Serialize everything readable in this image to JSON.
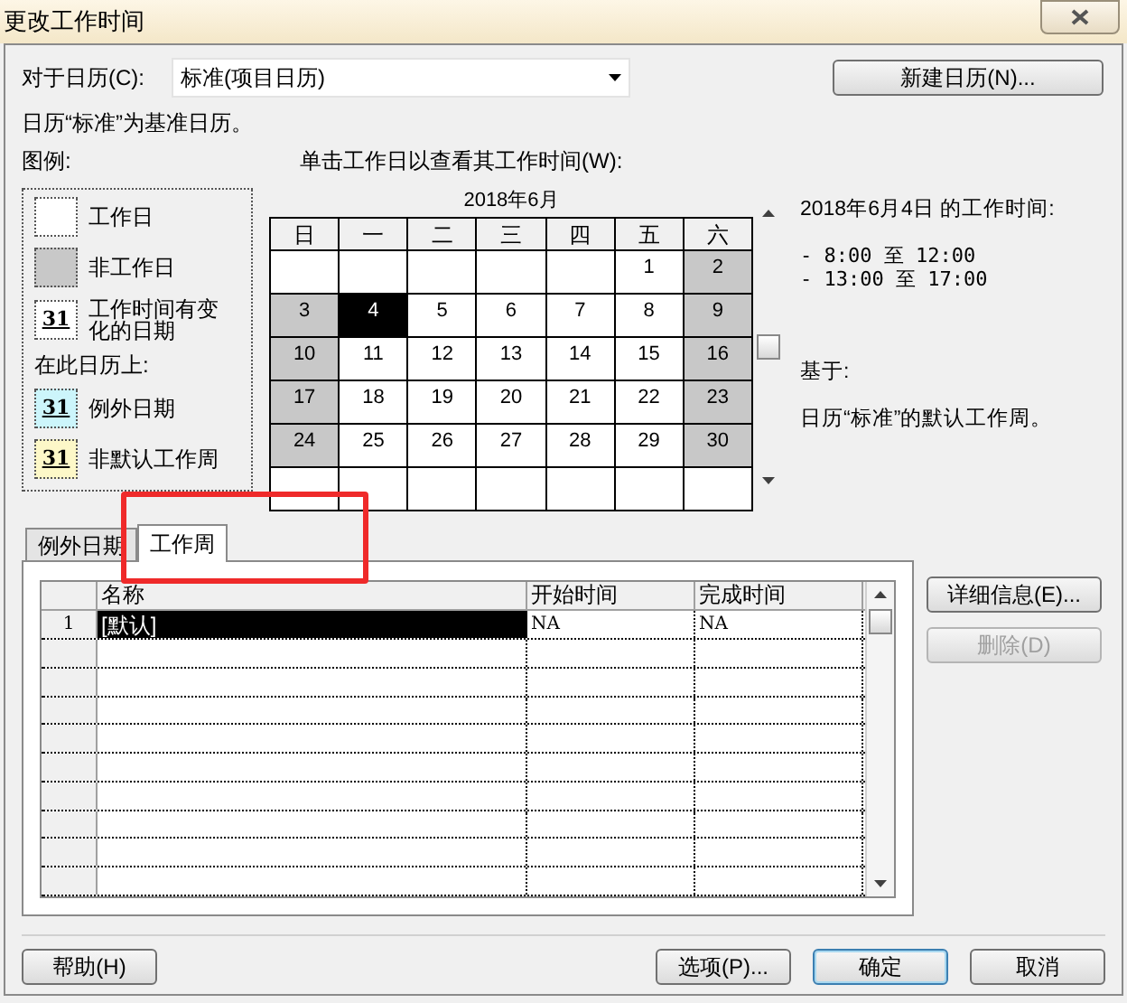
{
  "window": {
    "title": "更改工作时间"
  },
  "calendar_select": {
    "label": "对于日历(C):",
    "value": "标准(项目日历)"
  },
  "new_calendar_button": "新建日历(N)...",
  "base_note": "日历“标准”为基准日历。",
  "legend": {
    "title": "图例:",
    "subtitle": "在此日历上:",
    "items": [
      {
        "kind": "working",
        "label": "工作日"
      },
      {
        "kind": "nonworking",
        "label": "非工作日"
      },
      {
        "kind": "changed",
        "label": "工作时间有变化的日期",
        "sample": "31"
      },
      {
        "kind": "exception",
        "label": "例外日期",
        "sample": "31"
      },
      {
        "kind": "nondefault",
        "label": "非默认工作周",
        "sample": "31"
      }
    ]
  },
  "calendar": {
    "instruction": "单击工作日以查看其工作时间(W):",
    "month": "2018年6月",
    "weekdays": [
      "日",
      "一",
      "二",
      "三",
      "四",
      "五",
      "六"
    ],
    "weeks": [
      [
        {
          "kind": "working",
          "selected": false
        },
        {
          "kind": "working",
          "selected": false
        },
        {
          "kind": "working",
          "selected": false
        },
        {
          "kind": "working",
          "selected": false
        },
        {
          "kind": "working",
          "selected": false
        },
        {
          "day": "1",
          "kind": "working",
          "selected": false
        },
        {
          "day": "2",
          "kind": "nonworking",
          "selected": false
        }
      ],
      [
        {
          "day": "3",
          "kind": "nonworking",
          "selected": false
        },
        {
          "day": "4",
          "kind": "working",
          "selected": true
        },
        {
          "day": "5",
          "kind": "working",
          "selected": false
        },
        {
          "day": "6",
          "kind": "working",
          "selected": false
        },
        {
          "day": "7",
          "kind": "working",
          "selected": false
        },
        {
          "day": "8",
          "kind": "working",
          "selected": false
        },
        {
          "day": "9",
          "kind": "nonworking",
          "selected": false
        }
      ],
      [
        {
          "day": "10",
          "kind": "nonworking",
          "selected": false
        },
        {
          "day": "11",
          "kind": "working",
          "selected": false
        },
        {
          "day": "12",
          "kind": "working",
          "selected": false
        },
        {
          "day": "13",
          "kind": "working",
          "selected": false
        },
        {
          "day": "14",
          "kind": "working",
          "selected": false
        },
        {
          "day": "15",
          "kind": "working",
          "selected": false
        },
        {
          "day": "16",
          "kind": "nonworking",
          "selected": false
        }
      ],
      [
        {
          "day": "17",
          "kind": "nonworking",
          "selected": false
        },
        {
          "day": "18",
          "kind": "working",
          "selected": false
        },
        {
          "day": "19",
          "kind": "working",
          "selected": false
        },
        {
          "day": "20",
          "kind": "working",
          "selected": false
        },
        {
          "day": "21",
          "kind": "working",
          "selected": false
        },
        {
          "day": "22",
          "kind": "working",
          "selected": false
        },
        {
          "day": "23",
          "kind": "nonworking",
          "selected": false
        }
      ],
      [
        {
          "day": "24",
          "kind": "nonworking",
          "selected": false
        },
        {
          "day": "25",
          "kind": "working",
          "selected": false
        },
        {
          "day": "26",
          "kind": "working",
          "selected": false
        },
        {
          "day": "27",
          "kind": "working",
          "selected": false
        },
        {
          "day": "28",
          "kind": "working",
          "selected": false
        },
        {
          "day": "29",
          "kind": "working",
          "selected": false
        },
        {
          "day": "30",
          "kind": "nonworking",
          "selected": false
        }
      ],
      [
        {
          "kind": "working",
          "selected": false
        },
        {
          "kind": "working",
          "selected": false
        },
        {
          "kind": "working",
          "selected": false
        },
        {
          "kind": "working",
          "selected": false
        },
        {
          "kind": "working",
          "selected": false
        },
        {
          "kind": "working",
          "selected": false
        },
        {
          "kind": "working",
          "selected": false
        }
      ]
    ]
  },
  "working_time": {
    "heading": "2018年6月4日 的工作时间:",
    "ranges": [
      "- 8:00 至 12:00",
      "- 13:00 至 17:00"
    ],
    "based_on_label": "基于:",
    "based_on": "日历“标准”的默认工作周。"
  },
  "tabs": [
    {
      "label": "例外日期",
      "selected": false
    },
    {
      "label": "工作周",
      "selected": true
    }
  ],
  "table": {
    "columns": [
      "名称",
      "开始时间",
      "完成时间"
    ],
    "rows": [
      {
        "number": "1",
        "cells": [
          "[默认]",
          "NA",
          "NA"
        ],
        "selected": true
      }
    ]
  },
  "side_buttons": [
    {
      "label": "详细信息(E)...",
      "disabled": false
    },
    {
      "label": "删除(D)",
      "disabled": true
    }
  ],
  "footer_buttons": [
    {
      "label": "帮助(H)",
      "default": false
    },
    {
      "label": "选项(P)...",
      "default": false
    },
    {
      "label": "确定",
      "default": true
    },
    {
      "label": "取消",
      "default": false
    }
  ],
  "annotation": {
    "visible": true
  }
}
